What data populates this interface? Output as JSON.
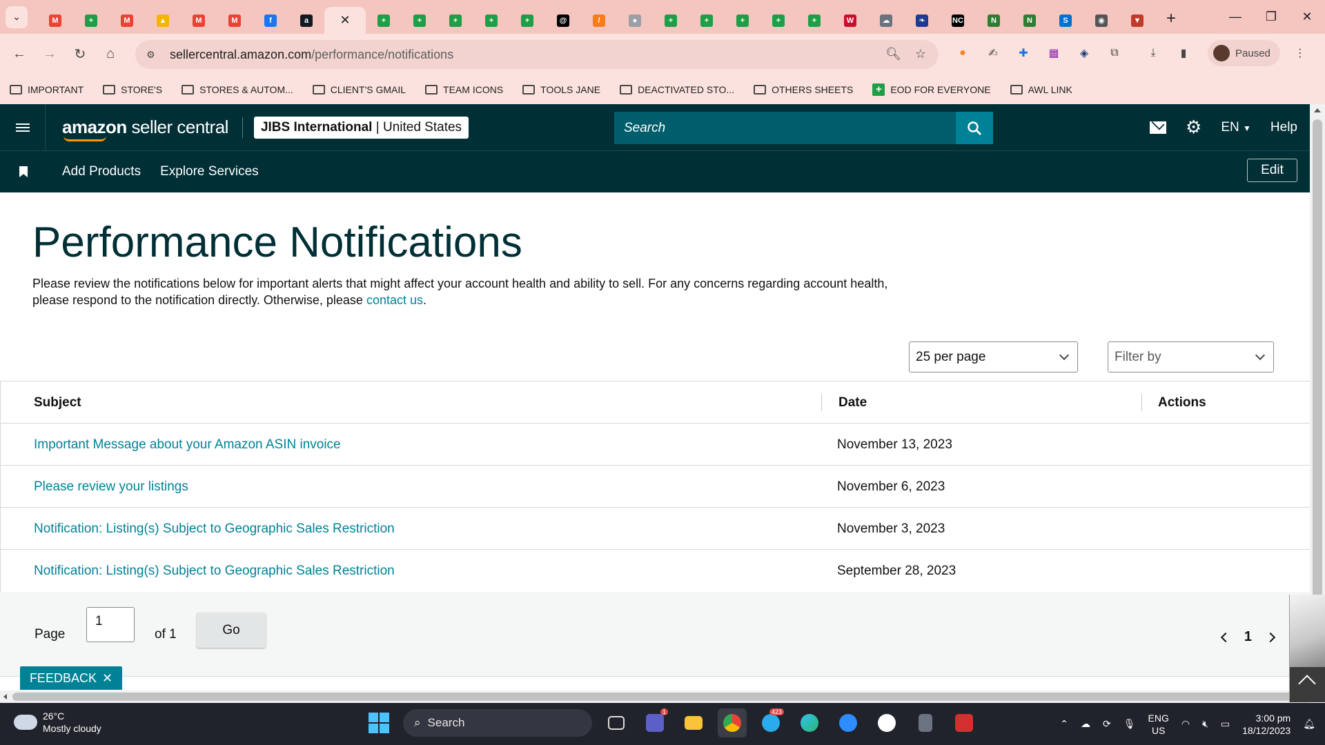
{
  "browser": {
    "tabs": [
      {
        "icon": "gmail-icon",
        "color": "#ea4335",
        "glyph": "M"
      },
      {
        "icon": "sheets-icon",
        "color": "#1e9e47",
        "glyph": "+"
      },
      {
        "icon": "gmail-icon",
        "color": "#ea4335",
        "glyph": "M"
      },
      {
        "icon": "drive-icon",
        "color": "#f4b400",
        "glyph": "▲"
      },
      {
        "icon": "gmail-icon",
        "color": "#ea4335",
        "glyph": "M"
      },
      {
        "icon": "gmail-icon",
        "color": "#ea4335",
        "glyph": "M"
      },
      {
        "icon": "facebook-icon",
        "color": "#1877f2",
        "glyph": "f"
      },
      {
        "icon": "amazon-icon",
        "color": "#131921",
        "glyph": "a"
      },
      {
        "icon": "close-icon",
        "color": "",
        "glyph": "✕",
        "active": true
      },
      {
        "icon": "sheets-icon",
        "color": "#1e9e47",
        "glyph": "+"
      },
      {
        "icon": "sheets-icon",
        "color": "#1e9e47",
        "glyph": "+"
      },
      {
        "icon": "sheets-icon",
        "color": "#1e9e47",
        "glyph": "+"
      },
      {
        "icon": "sheets-icon",
        "color": "#1e9e47",
        "glyph": "+"
      },
      {
        "icon": "sheets-icon",
        "color": "#1e9e47",
        "glyph": "+"
      },
      {
        "icon": "threads-icon",
        "color": "#000000",
        "glyph": "@"
      },
      {
        "icon": "pen-icon",
        "color": "#f97c1c",
        "glyph": "/"
      },
      {
        "icon": "globe-icon",
        "color": "#9aa0a6",
        "glyph": "●"
      },
      {
        "icon": "sheets-icon",
        "color": "#1e9e47",
        "glyph": "+"
      },
      {
        "icon": "sheets-icon",
        "color": "#1e9e47",
        "glyph": "+"
      },
      {
        "icon": "sheets-icon",
        "color": "#1e9e47",
        "glyph": "+"
      },
      {
        "icon": "sheets-icon",
        "color": "#1e9e47",
        "glyph": "+"
      },
      {
        "icon": "sheets-icon",
        "color": "#1e9e47",
        "glyph": "+"
      },
      {
        "icon": "wps-icon",
        "color": "#c8102e",
        "glyph": "W"
      },
      {
        "icon": "cloud-icon",
        "color": "#6b7280",
        "glyph": "☁"
      },
      {
        "icon": "leaf-icon",
        "color": "#1f3a93",
        "glyph": "❧"
      },
      {
        "icon": "nc-icon",
        "color": "#000000",
        "glyph": "NC"
      },
      {
        "icon": "n-logo-icon",
        "color": "#2e7d32",
        "glyph": "N"
      },
      {
        "icon": "n-logo-icon",
        "color": "#2e7d32",
        "glyph": "N"
      },
      {
        "icon": "sysco-icon",
        "color": "#0071ce",
        "glyph": "S"
      },
      {
        "icon": "circle-logo-icon",
        "color": "#555555",
        "glyph": "◉"
      },
      {
        "icon": "shield-icon",
        "color": "#c0392b",
        "glyph": "▼"
      }
    ],
    "url_host": "sellercentral.amazon.com",
    "url_path": "/performance/notifications",
    "profile_label": "Paused",
    "bookmarks": [
      {
        "type": "folder",
        "label": "IMPORTANT"
      },
      {
        "type": "folder",
        "label": "STORE'S"
      },
      {
        "type": "folder",
        "label": "STORES & AUTOM..."
      },
      {
        "type": "folder",
        "label": "CLIENT'S GMAIL"
      },
      {
        "type": "folder",
        "label": "TEAM ICONS"
      },
      {
        "type": "folder",
        "label": "TOOLS JANE"
      },
      {
        "type": "folder",
        "label": "DEACTIVATED STO..."
      },
      {
        "type": "folder",
        "label": "OTHERS SHEETS"
      },
      {
        "type": "sheet",
        "label": "EOD FOR EVERYONE"
      },
      {
        "type": "folder",
        "label": "AWL LINK"
      }
    ]
  },
  "header": {
    "logo_bold": "amazon",
    "logo_rest": " seller central",
    "account_name": "JIBS International",
    "account_region": "United States",
    "search_placeholder": "Search",
    "language": "EN",
    "help": "Help",
    "subnav": [
      "Add Products",
      "Explore Services"
    ],
    "edit": "Edit"
  },
  "page": {
    "title": "Performance Notifications",
    "intro_text": "Please review the notifications below for important alerts that might affect your account health and ability to sell. For any concerns regarding account health, please respond to the notification directly. Otherwise, please ",
    "intro_link": "contact us",
    "intro_end": ".",
    "per_page": "25 per page",
    "filter_placeholder": "Filter by",
    "columns": {
      "subject": "Subject",
      "date": "Date",
      "actions": "Actions"
    },
    "rows": [
      {
        "subject": "Important Message about your Amazon ASIN invoice",
        "date": "November 13, 2023"
      },
      {
        "subject": "Please review your listings",
        "date": "November 6, 2023"
      },
      {
        "subject": "Notification: Listing(s) Subject to Geographic Sales Restriction",
        "date": "November 3, 2023"
      },
      {
        "subject": "Notification: Listing(s) Subject to Geographic Sales Restriction",
        "date": "September 28, 2023"
      }
    ],
    "pager": {
      "page_label": "Page",
      "page_value": "1",
      "of_label": "of 1",
      "go": "Go",
      "current": "1"
    },
    "feedback": "FEEDBACK"
  },
  "taskbar": {
    "temp": "26°C",
    "weather": "Mostly cloudy",
    "search": "Search",
    "teams_badge": "1",
    "telegram_badge": "423",
    "lang_1": "ENG",
    "lang_2": "US",
    "time": "3:00 pm",
    "date": "18/12/2023"
  }
}
